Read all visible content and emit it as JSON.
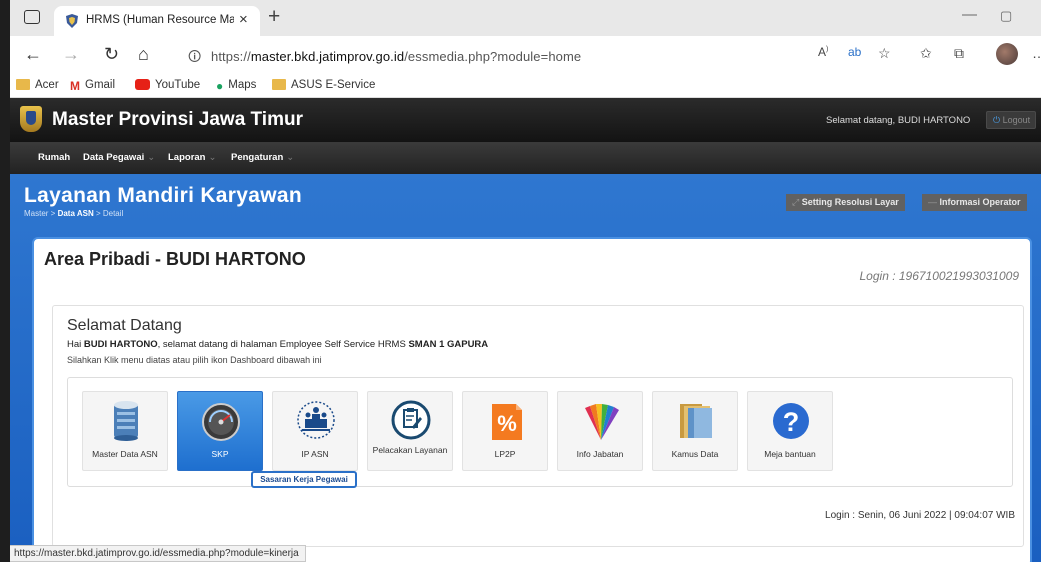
{
  "browser": {
    "tab_title": "HRMS (Human Resource Manage",
    "url_prefix": "https://",
    "url_host": "master.bkd.jatimprov.go.id",
    "url_path": "/essmedia.php?module=home",
    "bookmarks": [
      {
        "label": "Acer",
        "icon": "folder-icon"
      },
      {
        "label": "Gmail",
        "icon": "gmail-icon"
      },
      {
        "label": "YouTube",
        "icon": "youtube-icon"
      },
      {
        "label": "Maps",
        "icon": "maps-icon"
      },
      {
        "label": "ASUS E-Service",
        "icon": "folder-icon"
      }
    ],
    "status_url": "https://master.bkd.jatimprov.go.id/essmedia.php?module=kinerja"
  },
  "site": {
    "title": "Master Provinsi Jawa Timur",
    "welcome_prefix": "Selamat datang,",
    "user_name": "BUDI HARTONO",
    "logout_label": "Logout",
    "menu": [
      {
        "label": "Rumah"
      },
      {
        "label": "Data Pegawai"
      },
      {
        "label": "Laporan"
      },
      {
        "label": "Pengaturan"
      }
    ]
  },
  "page": {
    "title": "Layanan Mandiri Karyawan",
    "breadcrumb": [
      "Master",
      "Data ASN",
      "Detail"
    ],
    "btn_resolution": "Setting Resolusi Layar",
    "btn_operator": "Informasi Operator",
    "area_title": "Area Pribadi - BUDI HARTONO",
    "login_id": "Login : 196710021993031009",
    "welcome_title": "Selamat Datang",
    "welcome_hai": "Hai",
    "welcome_name": "BUDI HARTONO",
    "welcome_mid": ", selamat datang di halaman Employee Self Service HRMS",
    "welcome_school": "SMAN 1 GAPURA",
    "instruction": "Silahkan Klik menu diatas atau pilih ikon Dashboard dibawah ini",
    "tiles": [
      {
        "label": "Master Data ASN",
        "icon": "database-icon"
      },
      {
        "label": "SKP",
        "icon": "speedometer-icon"
      },
      {
        "label": "IP ASN",
        "icon": "podium-icon"
      },
      {
        "label": "Pelacakan Layanan",
        "icon": "clipboard-icon"
      },
      {
        "label": "LP2P",
        "icon": "percent-icon"
      },
      {
        "label": "Info Jabatan",
        "icon": "color-fan-icon"
      },
      {
        "label": "Kamus Data",
        "icon": "book-icon"
      },
      {
        "label": "Meja bantuan",
        "icon": "help-icon"
      }
    ],
    "tooltip": "Sasaran Kerja Pegawai",
    "login_footer": "Login : Senin, 06 Juni 2022 | 09:04:07 WIB"
  }
}
